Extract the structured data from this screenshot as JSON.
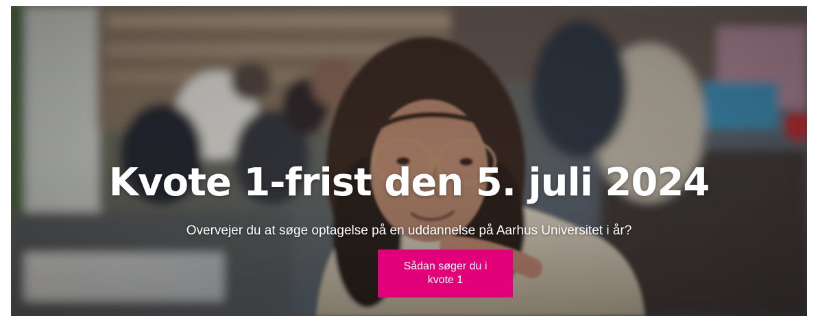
{
  "hero": {
    "title": "Kvote 1-frist den 5. juli 2024",
    "subtitle": "Overvejer du at søge optagelse på en uddannelse på Aarhus Universitet i år?",
    "cta_label": "Sådan søger du i kvote 1",
    "image_alt": "",
    "colors": {
      "cta_background": "#e2007a",
      "text": "#ffffff"
    }
  }
}
